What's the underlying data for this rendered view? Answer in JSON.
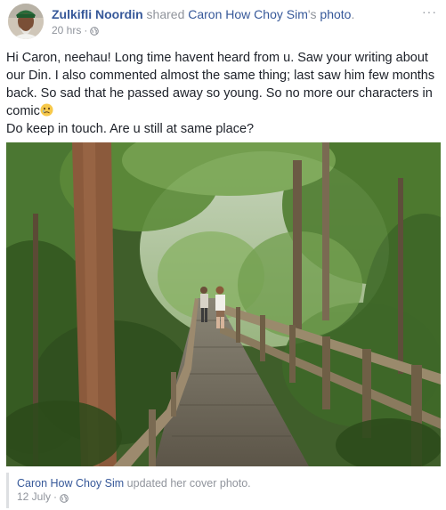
{
  "post": {
    "author": "Zulkifli Noordin",
    "shared_text": " shared ",
    "shared_owner": "Caron How Choy Sim",
    "shared_suffix": "'s ",
    "shared_object": "photo",
    "shared_period": ".",
    "timestamp": "20 hrs",
    "separator": "·",
    "more_label": "···",
    "privacy_icon": "globe-icon",
    "body": {
      "line1": "Hi Caron, neehau! Long time havent heard from u. Saw your writing about our Din. I also commented almost the same thing; last saw him few months back. So sad that he passed away so young. So no more our characters in comic",
      "emoji": "sad-face-emoji",
      "line2": "Do keep in touch. Are u still at same place?"
    }
  },
  "attachment": {
    "owner": "Caron How Choy Sim",
    "action": " updated her cover photo.",
    "date": "12 July",
    "separator": "·",
    "privacy_icon": "globe-icon"
  },
  "colors": {
    "link": "#365899",
    "meta": "#90949c",
    "text": "#1d2129"
  }
}
